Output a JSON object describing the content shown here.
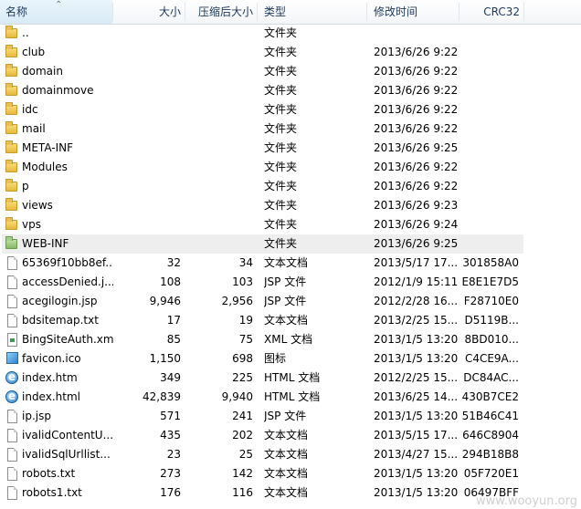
{
  "columns": {
    "name": "名称",
    "size": "大小",
    "compressed": "压缩后大小",
    "type": "类型",
    "modified": "修改时间",
    "crc": "CRC32"
  },
  "rows": [
    {
      "icon": "folder-icon",
      "name": "..",
      "size": "",
      "compressed": "",
      "type": "文件夹",
      "modified": "",
      "crc": ""
    },
    {
      "icon": "folder-icon",
      "name": "club",
      "size": "",
      "compressed": "",
      "type": "文件夹",
      "modified": "2013/6/26 9:22",
      "crc": ""
    },
    {
      "icon": "folder-icon",
      "name": "domain",
      "size": "",
      "compressed": "",
      "type": "文件夹",
      "modified": "2013/6/26 9:22",
      "crc": ""
    },
    {
      "icon": "folder-icon",
      "name": "domainmove",
      "size": "",
      "compressed": "",
      "type": "文件夹",
      "modified": "2013/6/26 9:22",
      "crc": ""
    },
    {
      "icon": "folder-icon",
      "name": "idc",
      "size": "",
      "compressed": "",
      "type": "文件夹",
      "modified": "2013/6/26 9:22",
      "crc": ""
    },
    {
      "icon": "folder-icon",
      "name": "mail",
      "size": "",
      "compressed": "",
      "type": "文件夹",
      "modified": "2013/6/26 9:22",
      "crc": ""
    },
    {
      "icon": "folder-icon",
      "name": "META-INF",
      "size": "",
      "compressed": "",
      "type": "文件夹",
      "modified": "2013/6/26 9:25",
      "crc": ""
    },
    {
      "icon": "folder-icon",
      "name": "Modules",
      "size": "",
      "compressed": "",
      "type": "文件夹",
      "modified": "2013/6/26 9:22",
      "crc": ""
    },
    {
      "icon": "folder-icon",
      "name": "p",
      "size": "",
      "compressed": "",
      "type": "文件夹",
      "modified": "2013/6/26 9:22",
      "crc": ""
    },
    {
      "icon": "folder-icon",
      "name": "views",
      "size": "",
      "compressed": "",
      "type": "文件夹",
      "modified": "2013/6/26 9:23",
      "crc": ""
    },
    {
      "icon": "folder-icon",
      "name": "vps",
      "size": "",
      "compressed": "",
      "type": "文件夹",
      "modified": "2013/6/26 9:24",
      "crc": ""
    },
    {
      "icon": "folder-green-icon",
      "name": "WEB-INF",
      "size": "",
      "compressed": "",
      "type": "文件夹",
      "modified": "2013/6/26 9:25",
      "crc": "",
      "selected": true
    },
    {
      "icon": "file-icon",
      "name": "65369f10bb8ef...",
      "size": "32",
      "compressed": "34",
      "type": "文本文档",
      "modified": "2013/5/17 17...",
      "crc": "301858A0"
    },
    {
      "icon": "file-icon",
      "name": "accessDenied.j...",
      "size": "108",
      "compressed": "103",
      "type": "JSP 文件",
      "modified": "2012/1/9 15:11",
      "crc": "E8E1E7D5"
    },
    {
      "icon": "file-icon",
      "name": "acegilogin.jsp",
      "size": "9,946",
      "compressed": "2,956",
      "type": "JSP 文件",
      "modified": "2012/2/28 16...",
      "crc": "F28710E0"
    },
    {
      "icon": "file-icon",
      "name": "bdsitemap.txt",
      "size": "17",
      "compressed": "19",
      "type": "文本文档",
      "modified": "2013/2/25 15...",
      "crc": "D5119B..."
    },
    {
      "icon": "xml-icon",
      "name": "BingSiteAuth.xml",
      "size": "85",
      "compressed": "75",
      "type": "XML 文档",
      "modified": "2013/1/5 13:20",
      "crc": "8BD010..."
    },
    {
      "icon": "ico-icon",
      "name": "favicon.ico",
      "size": "1,150",
      "compressed": "698",
      "type": "图标",
      "modified": "2013/1/5 13:20",
      "crc": "C4CE9A..."
    },
    {
      "icon": "web-icon",
      "name": "index.htm",
      "size": "349",
      "compressed": "225",
      "type": "HTML 文档",
      "modified": "2012/2/25 15...",
      "crc": "DC84AC..."
    },
    {
      "icon": "web-icon",
      "name": "index.html",
      "size": "42,839",
      "compressed": "9,940",
      "type": "HTML 文档",
      "modified": "2013/6/25 14...",
      "crc": "430B7CE2"
    },
    {
      "icon": "file-icon",
      "name": "ip.jsp",
      "size": "571",
      "compressed": "241",
      "type": "JSP 文件",
      "modified": "2013/1/5 13:20",
      "crc": "51B46C41"
    },
    {
      "icon": "file-icon",
      "name": "ivalidContentU...",
      "size": "435",
      "compressed": "202",
      "type": "文本文档",
      "modified": "2013/5/15 17...",
      "crc": "646C8904"
    },
    {
      "icon": "file-icon",
      "name": "ivalidSqlUrllist...",
      "size": "23",
      "compressed": "25",
      "type": "文本文档",
      "modified": "2013/4/27 15...",
      "crc": "294B18B8"
    },
    {
      "icon": "file-icon",
      "name": "robots.txt",
      "size": "273",
      "compressed": "142",
      "type": "文本文档",
      "modified": "2013/1/5 13:20",
      "crc": "05F720E1"
    },
    {
      "icon": "file-icon",
      "name": "robots1.txt",
      "size": "176",
      "compressed": "116",
      "type": "文本文档",
      "modified": "2013/1/5 13:20",
      "crc": "06497BFF"
    }
  ],
  "watermark": "www.wooyun.org"
}
